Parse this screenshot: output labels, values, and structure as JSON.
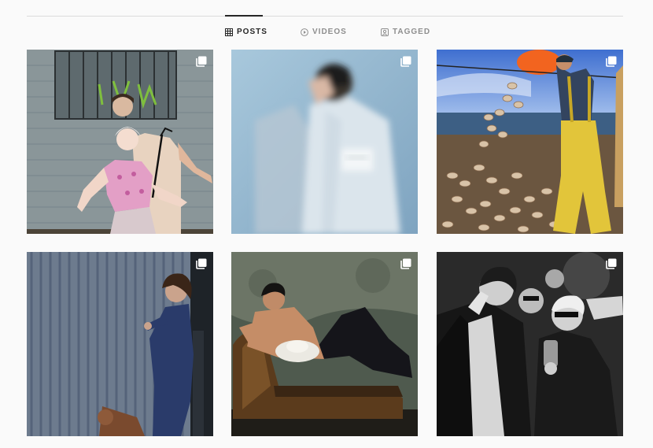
{
  "tabs": [
    {
      "label": "POSTS",
      "icon": "grid-icon",
      "active": true
    },
    {
      "label": "VIDEOS",
      "icon": "play-circle-icon",
      "active": false
    },
    {
      "label": "TAGGED",
      "icon": "tagged-user-icon",
      "active": false
    }
  ],
  "posts": [
    {
      "subject": "couple-against-wall-photo",
      "icon": "multiple-photos-icon"
    },
    {
      "subject": "blurred-man-portrait-photo",
      "icon": "multiple-photos-icon"
    },
    {
      "subject": "fisherman-scallops-photo",
      "icon": "multiple-photos-icon"
    },
    {
      "subject": "man-by-corrugated-wall-photo",
      "icon": "multiple-photos-icon"
    },
    {
      "subject": "man-on-chaise-longue-photo",
      "icon": "multiple-photos-icon"
    },
    {
      "subject": "party-group-bw-photo",
      "icon": "multiple-photos-icon"
    }
  ],
  "colors": {
    "background": "#fafafa",
    "active_tab": "#262626",
    "inactive_tab": "#8e8e8e",
    "divider": "#dbdbdb"
  }
}
